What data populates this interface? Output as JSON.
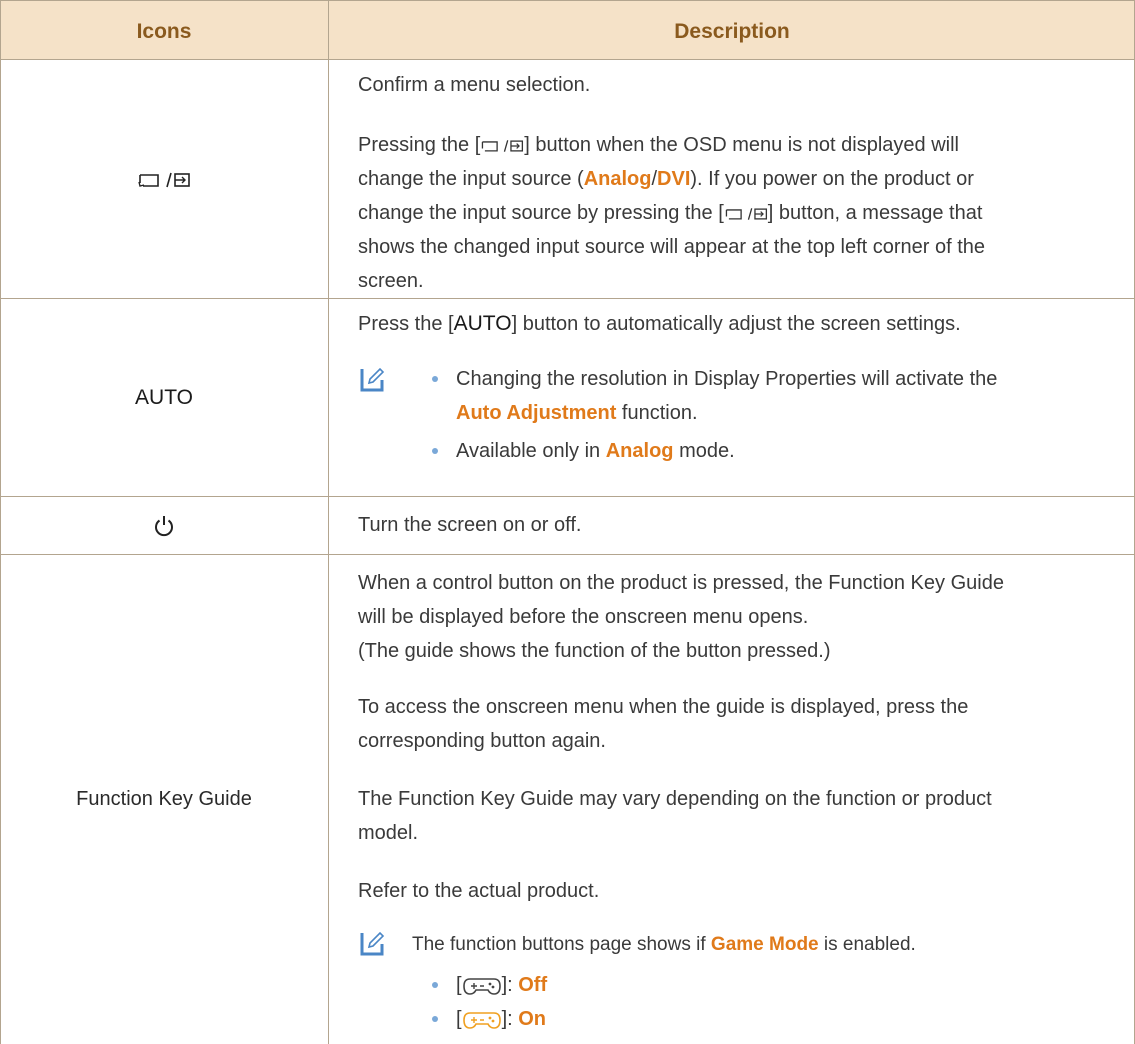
{
  "header": {
    "icons_label": "Icons",
    "description_label": "Description"
  },
  "row_source": {
    "icon_name": "source-enter-icon",
    "p1": "Confirm a menu selection.",
    "p2_a": "Pressing the [",
    "p2_b": "] button when the OSD menu is not displayed will",
    "p2_c": "change the input source (",
    "analog": "Analog",
    "slash": "/",
    "dvi": "DVI",
    "p2_d": "). If you power on the product or",
    "p2_e": "change the input source by pressing the [",
    "p2_f": "] button, a message that",
    "p2_g": "shows the changed input source will appear at the top left corner of the",
    "p2_h": "screen."
  },
  "row_auto": {
    "icon_label": "AUTO",
    "p1_a": "Press the [",
    "p1_auto": "AUTO",
    "p1_b": "] button to automatically adjust the screen settings.",
    "b1_a": "Changing the resolution in Display Properties will activate the",
    "b1_hl": "Auto Adjustment",
    "b1_b": " function.",
    "b2_a": "Available only in ",
    "b2_hl": "Analog",
    "b2_b": " mode."
  },
  "row_power": {
    "icon_name": "power-icon",
    "p1": "Turn the screen on or off."
  },
  "row_guide": {
    "icon_label": "Function Key Guide",
    "p1_l1": "When a control button on the product is pressed, the Function Key Guide",
    "p1_l2": "will be displayed before the onscreen menu opens.",
    "p1_l3": "(The guide shows the function of the button pressed.)",
    "p2_l1": "To access the onscreen menu when the guide is displayed, press the",
    "p2_l2": "corresponding button again.",
    "p3_l1": "The Function Key Guide may vary depending on the function or product",
    "p3_l2": "model.",
    "p4": "Refer to the actual product.",
    "note_a": "The function buttons page shows if ",
    "note_hl": "Game Mode",
    "note_b": " is enabled.",
    "off_bracket_a": "[",
    "off_bracket_b": "]: ",
    "off_label": "Off",
    "on_label": "On"
  },
  "colors": {
    "accent": "#e07a1a",
    "header_bg": "#f5e2c8",
    "header_text": "#8a5a1e",
    "bullet": "#7aa8d8",
    "border": "#b3a58f"
  }
}
